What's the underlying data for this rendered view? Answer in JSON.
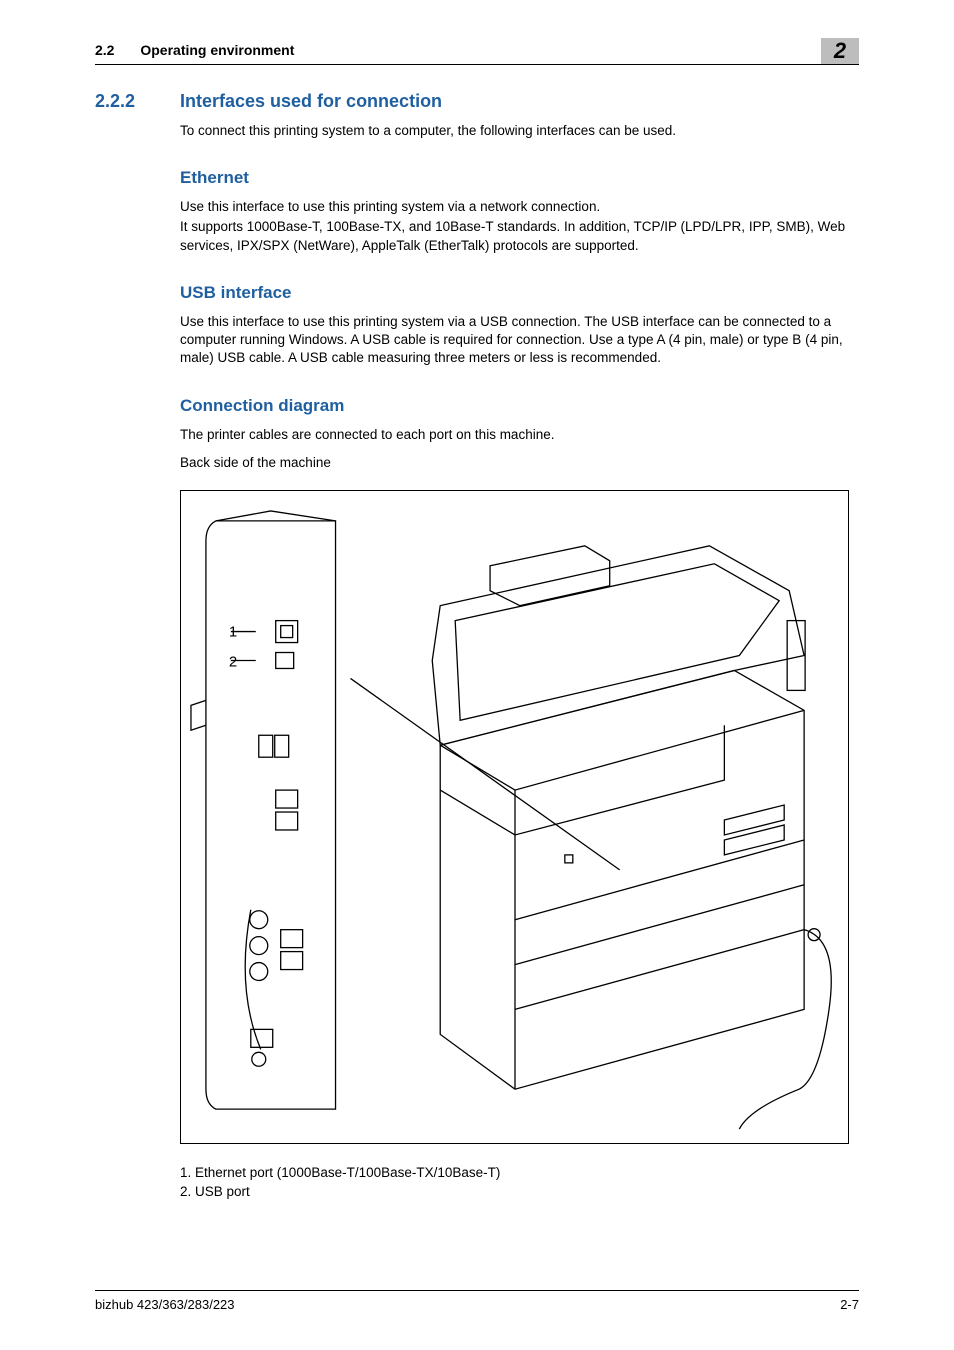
{
  "header": {
    "section_num": "2.2",
    "section_title": "Operating environment",
    "chapter_num": "2"
  },
  "section": {
    "num": "2.2.2",
    "title": "Interfaces used for connection",
    "intro": "To connect this printing system to a computer, the following interfaces can be used."
  },
  "ethernet": {
    "title": "Ethernet",
    "p1": "Use this interface to use this printing system via a network connection.",
    "p2": "It supports 1000Base-T, 100Base-TX, and 10Base-T standards. In addition, TCP/IP (LPD/LPR, IPP, SMB), Web services, IPX/SPX (NetWare), AppleTalk (EtherTalk) protocols are supported."
  },
  "usb": {
    "title": "USB interface",
    "p1": "Use this interface to use this printing system via a USB connection. The USB interface can be connected to a computer running Windows. A USB cable is required for connection. Use a type A (4 pin, male) or type B (4 pin, male) USB cable. A USB cable measuring three meters or less is recommended."
  },
  "diagram": {
    "title": "Connection diagram",
    "p1": "The printer cables are connected to each port on this machine.",
    "p2": "Back side of the machine",
    "callout1": "1",
    "callout2": "2",
    "legend1": "1. Ethernet port (1000Base-T/100Base-TX/10Base-T)",
    "legend2": "2. USB port"
  },
  "footer": {
    "left": "bizhub 423/363/283/223",
    "right": "2-7"
  }
}
